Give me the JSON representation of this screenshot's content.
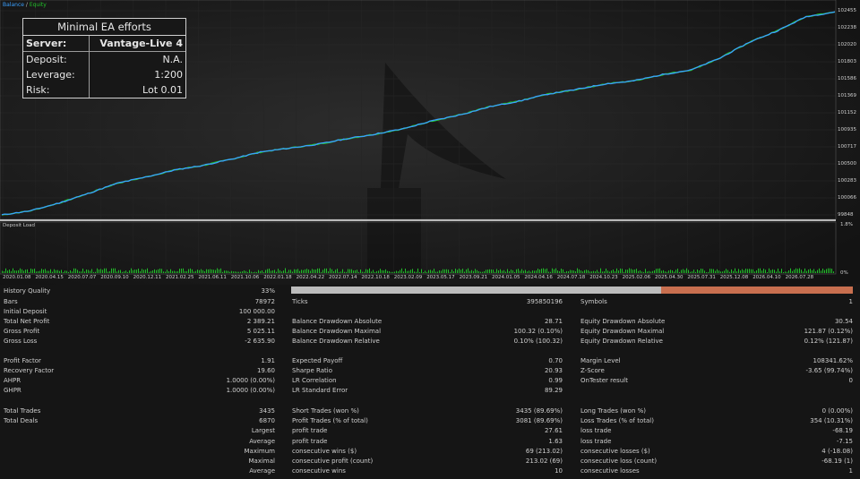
{
  "legend": {
    "balance": "Balance",
    "separator": "/",
    "equity": "Equity"
  },
  "info_box": {
    "title": "Minimal EA efforts",
    "rows": [
      {
        "label": "Server:",
        "value": "Vantage-Live 4"
      },
      {
        "label": "Deposit:",
        "value": "N.A."
      },
      {
        "label": "Leverage:",
        "value": "1:200"
      },
      {
        "label": "Risk:",
        "value": "Lot 0.01"
      }
    ]
  },
  "y_axis": [
    "102455",
    "102238",
    "102020",
    "101803",
    "101586",
    "101369",
    "101152",
    "100935",
    "100717",
    "100500",
    "100283",
    "100066",
    "99848"
  ],
  "deposit_load": {
    "label": "Deposit Load",
    "top_tick": "1.8%",
    "bottom_tick": "0%"
  },
  "x_axis": [
    "2020.01.08",
    "2020.04.15",
    "2020.07.07",
    "2020.09.10",
    "2020.12.11",
    "2021.02.25",
    "2021.06.11",
    "2021.10.06",
    "2022.01.18",
    "2022.04.22",
    "2022.07.14",
    "2022.10.18",
    "2023.02.09",
    "2023.05.17",
    "2023.09.21",
    "2024.01.05",
    "2024.04.16",
    "2024.07.18",
    "2024.10.23",
    "2025.02.06",
    "2025.04.30",
    "2025.07.31",
    "2025.12.08",
    "2026.04.10",
    "2026.07.28"
  ],
  "colors": {
    "balance": "#3aa0ff",
    "equity": "#22c02a",
    "bar_gray": "#bcbcbc",
    "bar_orange": "#c86f4f"
  },
  "chart_data": {
    "type": "line",
    "series": [
      {
        "name": "Balance",
        "values": [
          99848,
          99900,
          100000,
          100120,
          100250,
          100330,
          100420,
          100480,
          100560,
          100650,
          100700,
          100750,
          100820,
          100880,
          100950,
          101050,
          101130,
          101230,
          101300,
          101390,
          101450,
          101520,
          101560,
          101640,
          101700,
          101850,
          102050,
          102200,
          102380,
          102440
        ]
      },
      {
        "name": "Equity",
        "values": [
          99848,
          99900,
          100000,
          100120,
          100250,
          100330,
          100420,
          100480,
          100560,
          100650,
          100700,
          100750,
          100820,
          100880,
          100950,
          101050,
          101130,
          101230,
          101300,
          101390,
          101450,
          101520,
          101560,
          101640,
          101700,
          101850,
          102050,
          102200,
          102380,
          102440
        ]
      }
    ],
    "ylim": [
      99848,
      102455
    ]
  },
  "report": {
    "history_quality": {
      "label": "History Quality",
      "value": "33%"
    },
    "bars": {
      "label": "Bars",
      "value": "78972"
    },
    "ticks": {
      "label": "Ticks",
      "value": "395850196"
    },
    "symbols": {
      "label": "Symbols",
      "value": "1"
    },
    "initial_deposit": {
      "label": "Initial Deposit",
      "value": "100 000.00"
    },
    "net_profit": {
      "label": "Total Net Profit",
      "value": "2 389.21"
    },
    "gross_profit": {
      "label": "Gross Profit",
      "value": "5 025.11"
    },
    "gross_loss": {
      "label": "Gross Loss",
      "value": "-2 635.90"
    },
    "bal_dd_abs": {
      "label": "Balance Drawdown Absolute",
      "value": "28.71"
    },
    "bal_dd_max": {
      "label": "Balance Drawdown Maximal",
      "value": "100.32 (0.10%)"
    },
    "bal_dd_rel": {
      "label": "Balance Drawdown Relative",
      "value": "0.10% (100.32)"
    },
    "eq_dd_abs": {
      "label": "Equity Drawdown Absolute",
      "value": "30.54"
    },
    "eq_dd_max": {
      "label": "Equity Drawdown Maximal",
      "value": "121.87 (0.12%)"
    },
    "eq_dd_rel": {
      "label": "Equity Drawdown Relative",
      "value": "0.12% (121.87)"
    },
    "profit_factor": {
      "label": "Profit Factor",
      "value": "1.91"
    },
    "recovery_factor": {
      "label": "Recovery Factor",
      "value": "19.60"
    },
    "ahpr": {
      "label": "AHPR",
      "value": "1.0000 (0.00%)"
    },
    "ghpr": {
      "label": "GHPR",
      "value": "1.0000 (0.00%)"
    },
    "expected_payoff": {
      "label": "Expected Payoff",
      "value": "0.70"
    },
    "sharpe": {
      "label": "Sharpe Ratio",
      "value": "20.93"
    },
    "lr_corr": {
      "label": "LR Correlation",
      "value": "0.99"
    },
    "lr_err": {
      "label": "LR Standard Error",
      "value": "89.29"
    },
    "margin_level": {
      "label": "Margin Level",
      "value": "108341.62%"
    },
    "z_score": {
      "label": "Z-Score",
      "value": "-3.65 (99.74%)"
    },
    "ontester": {
      "label": "OnTester result",
      "value": "0"
    },
    "total_trades": {
      "label": "Total Trades",
      "value": "3435"
    },
    "total_deals": {
      "label": "Total Deals",
      "value": "6870"
    },
    "short_trades": {
      "label": "Short Trades (won %)",
      "value": "3435 (89.69%)"
    },
    "profit_trades": {
      "label": "Profit Trades (% of total)",
      "value": "3081 (89.69%)"
    },
    "long_trades": {
      "label": "Long Trades (won %)",
      "value": "0 (0.00%)"
    },
    "loss_trades": {
      "label": "Loss Trades (% of total)",
      "value": "354 (10.31%)"
    },
    "largest": {
      "label": "Largest",
      "profit_label": "profit trade",
      "profit_value": "27.61",
      "loss_label": "loss trade",
      "loss_value": "-68.19"
    },
    "average": {
      "label": "Average",
      "profit_label": "profit trade",
      "profit_value": "1.63",
      "loss_label": "loss trade",
      "loss_value": "-7.15"
    },
    "maximum": {
      "label": "Maximum",
      "win_label": "consecutive wins ($)",
      "win_value": "69 (213.02)",
      "loss_label": "consecutive losses ($)",
      "loss_value": "4 (-18.08)"
    },
    "maximal": {
      "label": "Maximal",
      "win_label": "consecutive profit (count)",
      "win_value": "213.02 (69)",
      "loss_label": "consecutive loss (count)",
      "loss_value": "-68.19 (1)"
    },
    "average2": {
      "label": "Average",
      "win_label": "consecutive wins",
      "win_value": "10",
      "loss_label": "consecutive losses",
      "loss_value": "1"
    }
  }
}
